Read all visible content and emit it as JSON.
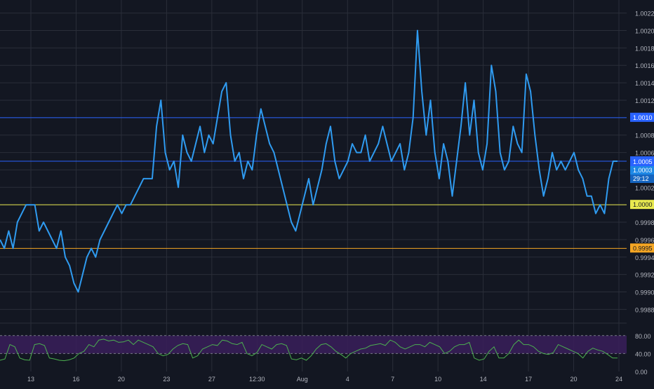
{
  "theme": {
    "background": "#131722",
    "grid": "#2a2e39",
    "price_line": "#2f9bf0",
    "level_blue": "#2962ff",
    "level_yellow": "#e8e94f",
    "level_orange": "#f5a623",
    "rsi_line": "#4caf50",
    "rsi_band": "#3a1f5a",
    "axis_text": "#b2b5be"
  },
  "chart_data": [
    {
      "type": "line",
      "pane": "price",
      "yticks": [
        "1.0022",
        "1.0020",
        "1.0018",
        "1.0016",
        "1.0014",
        "1.0012",
        "1.0010",
        "1.0008",
        "1.0006",
        "1.0004",
        "1.0002",
        "1.0000",
        "0.9998",
        "0.9996",
        "0.9994",
        "0.9992",
        "0.9990",
        "0.9988"
      ],
      "ylim": [
        0.99865,
        1.00235
      ],
      "xticks": [
        "13",
        "16",
        "20",
        "23",
        "27",
        "12:30",
        "Aug",
        "4",
        "7",
        "10",
        "14",
        "17",
        "20",
        "24"
      ],
      "levels": [
        {
          "value": 1.001,
          "label": "1.0010",
          "color": "#2962ff"
        },
        {
          "value": 1.0005,
          "label": "1.0005",
          "color": "#2962ff"
        },
        {
          "value": 1.0,
          "label": "1.0000",
          "color": "#e8e94f"
        },
        {
          "value": 0.9995,
          "label": "0.9995",
          "color": "#f5a623"
        }
      ],
      "price_tags": [
        {
          "text": "1.0005",
          "value": 1.0005
        },
        {
          "text": "1.0003",
          "value": 1.0003
        },
        {
          "text": "29:12",
          "value": 1.0002
        }
      ],
      "series": [
        {
          "values": [
            0.9996,
            0.9995,
            0.9997,
            0.9995,
            0.9998,
            0.9999,
            1.0,
            1.0,
            1.0,
            0.9997,
            0.9998,
            0.9997,
            0.9996,
            0.9995,
            0.9997,
            0.9994,
            0.9993,
            0.9991,
            0.999,
            0.9992,
            0.9994,
            0.9995,
            0.9994,
            0.9996,
            0.9997,
            0.9998,
            0.9999,
            1.0,
            0.9999,
            1.0,
            1.0,
            1.0001,
            1.0002,
            1.0003,
            1.0003,
            1.0003,
            1.0009,
            1.0012,
            1.0006,
            1.0004,
            1.0005,
            1.0002,
            1.0008,
            1.0006,
            1.0005,
            1.0007,
            1.0009,
            1.0006,
            1.0008,
            1.0007,
            1.001,
            1.0013,
            1.0014,
            1.0008,
            1.0005,
            1.0006,
            1.0003,
            1.0005,
            1.0004,
            1.0008,
            1.0011,
            1.0009,
            1.0007,
            1.0006,
            1.0004,
            1.0002,
            1.0,
            0.9998,
            0.9997,
            0.9999,
            1.0001,
            1.0003,
            1.0,
            1.0002,
            1.0004,
            1.0007,
            1.0009,
            1.0005,
            1.0003,
            1.0004,
            1.0005,
            1.0007,
            1.0006,
            1.0006,
            1.0008,
            1.0005,
            1.0006,
            1.0007,
            1.0009,
            1.0007,
            1.0005,
            1.0006,
            1.0007,
            1.0004,
            1.0006,
            1.001,
            1.002,
            1.0013,
            1.0008,
            1.0012,
            1.0006,
            1.0003,
            1.0007,
            1.0005,
            1.0001,
            1.0005,
            1.0009,
            1.0014,
            1.0008,
            1.0012,
            1.0006,
            1.0004,
            1.0007,
            1.0016,
            1.0013,
            1.0006,
            1.0004,
            1.0005,
            1.0009,
            1.0007,
            1.0006,
            1.0015,
            1.0013,
            1.0008,
            1.0004,
            1.0001,
            1.0003,
            1.0006,
            1.0004,
            1.0005,
            1.0004,
            1.0005,
            1.0006,
            1.0004,
            1.0003,
            1.0001,
            1.0001,
            0.9999,
            1.0,
            0.9999,
            1.0003,
            1.0005,
            1.0005
          ]
        }
      ]
    },
    {
      "type": "line",
      "pane": "oscillator",
      "yticks": [
        "80.00",
        "40.00",
        "0.00"
      ],
      "ylim": [
        0,
        100
      ],
      "band": [
        40,
        80
      ],
      "series": [
        {
          "values": [
            25,
            28,
            60,
            55,
            30,
            26,
            25,
            60,
            62,
            58,
            30,
            28,
            25,
            24,
            26,
            30,
            40,
            45,
            60,
            55,
            70,
            72,
            68,
            70,
            65,
            66,
            70,
            60,
            70,
            65,
            60,
            55,
            40,
            35,
            38,
            50,
            58,
            62,
            60,
            30,
            35,
            50,
            55,
            60,
            58,
            70,
            68,
            62,
            60,
            65,
            40,
            35,
            42,
            60,
            55,
            50,
            60,
            62,
            58,
            28,
            26,
            30,
            25,
            35,
            50,
            60,
            62,
            55,
            45,
            38,
            30,
            40,
            45,
            50,
            52,
            58,
            60,
            62,
            58,
            70,
            65,
            55,
            50,
            55,
            60,
            60,
            55,
            65,
            60,
            55,
            40,
            45,
            55,
            60,
            60,
            65,
            30,
            25,
            28,
            45,
            55,
            30,
            30,
            40,
            60,
            70,
            60,
            60,
            55,
            45,
            40,
            38,
            42,
            60,
            55,
            50,
            45,
            40,
            30,
            45,
            52,
            48,
            45,
            38,
            30,
            30
          ]
        }
      ]
    }
  ]
}
